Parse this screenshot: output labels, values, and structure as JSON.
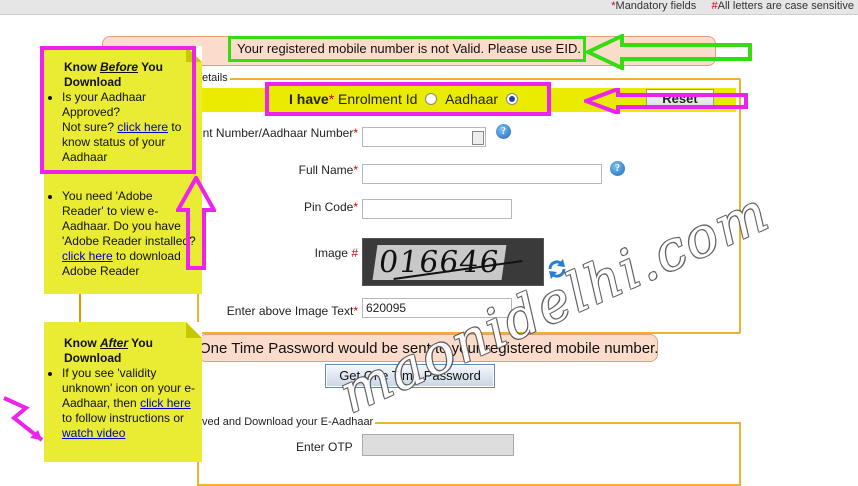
{
  "header": {
    "mandatory_mark": "*",
    "mandatory_text": "Mandatory fields",
    "case_mark": "#",
    "case_text": "All letters are case sensitive"
  },
  "alert": {
    "message": "Your registered mobile number is not Valid. Please use EID."
  },
  "form": {
    "legend": "etails",
    "have_label": "I have",
    "have_star": "*",
    "option_enrolment": "Enrolment Id",
    "option_aadhaar": "Aadhaar",
    "selected_option": "Aadhaar",
    "reset_label": "Reset",
    "number_label": "nt Number/Aadhaar Number",
    "number_value": "",
    "fullname_label": "Full Name",
    "fullname_value": "",
    "pincode_label": "Pin Code",
    "pincode_value": "",
    "image_label": "Image",
    "image_mark": "#",
    "captcha_text": "016646",
    "image_text_label": "Enter above Image Text",
    "image_text_value": "620095",
    "star": "*"
  },
  "otp": {
    "banner": "One Time Password would be sent to your registered mobile number.",
    "button_label": "Get One Time Password",
    "section_legend": "ved and Download your E-Aadhaar",
    "otp_label": "Enter OTP"
  },
  "note_before": {
    "title_prefix": "Know ",
    "title_emph": "Before",
    "title_suffix": " You Download",
    "item1_text": "Is your Aadhaar Approved?",
    "item1_not_sure": "Not sure? ",
    "item1_link": "click here",
    "item1_after": " to know status of your Aadhaar",
    "item2_text": "You need 'Adobe Reader' to view e-Aadhaar. Do you have 'Adobe Reader installed? ",
    "item2_link": "click here",
    "item2_after": " to download Adobe Reader"
  },
  "note_after": {
    "title_prefix": "Know ",
    "title_emph": "After",
    "title_suffix": " You Download",
    "item1_text": "If you see 'validity unknown' icon on your e-Aadhaar, then ",
    "item1_link": "click here",
    "item1_mid": " to follow instructions or ",
    "item1_link2": "watch video"
  },
  "watermark": "maonidelhi.com",
  "colors": {
    "highlight_green": "#33dd11",
    "highlight_magenta": "#ee22ee",
    "note_yellow": "#eaeb33",
    "fieldset_orange": "#f0b030",
    "banner_pink": "#fbdccb"
  }
}
